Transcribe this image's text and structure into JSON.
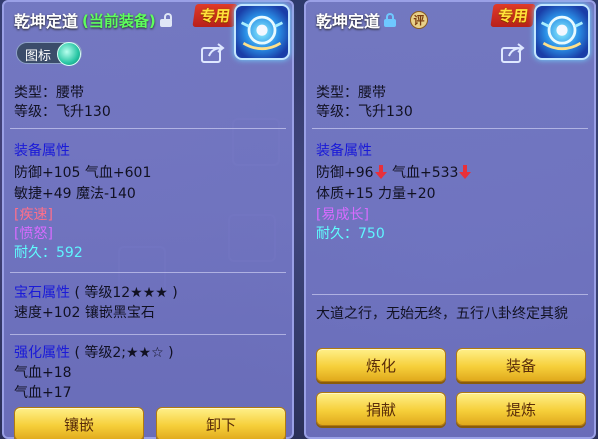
{
  "left": {
    "title": "乾坤定道",
    "current_equipped": "(当前装备)",
    "exclusive": "专用",
    "toggle_label": "图标",
    "type": "类型：腰带",
    "level": "等级：飞升130",
    "attr_head": "装备属性",
    "attr_line1": "防御+105 气血+601",
    "attr_line2": "敏捷+49 魔法-140",
    "skill1": "[疾速]",
    "skill2": "[愤怒]",
    "durability_label": "耐久：",
    "durability_value": "592",
    "gem_head": "宝石属性",
    "gem_level": "( 等级12★★★ )",
    "gem_line": "速度+102 镶嵌黑宝石",
    "enh_head": "强化属性",
    "enh_level": "( 等级2;★★☆ )",
    "enh_line1": "气血+18",
    "enh_line2": "气血+17",
    "btn_inlay": "镶嵌",
    "btn_unequip": "卸下"
  },
  "right": {
    "title": "乾坤定道",
    "rating": "评",
    "exclusive": "专用",
    "type": "类型：腰带",
    "level": "等级：飞升130",
    "attr_head": "装备属性",
    "attr_def": "防御+96",
    "attr_hp": "气血+533",
    "attr_line2": "体质+15 力量+20",
    "skill1": "[易成长]",
    "durability_label": "耐久：",
    "durability_value": "750",
    "desc": "大道之行，无始无终，五行八卦终定其貌",
    "btn_refine": "炼化",
    "btn_equip": "装备",
    "btn_donate": "捐献",
    "btn_extract": "提炼"
  },
  "icons": [
    "lock-open-icon",
    "lock-closed-icon",
    "share-icon",
    "belt-item-icon",
    "down-arrow-icon",
    "rating-badge-icon"
  ]
}
